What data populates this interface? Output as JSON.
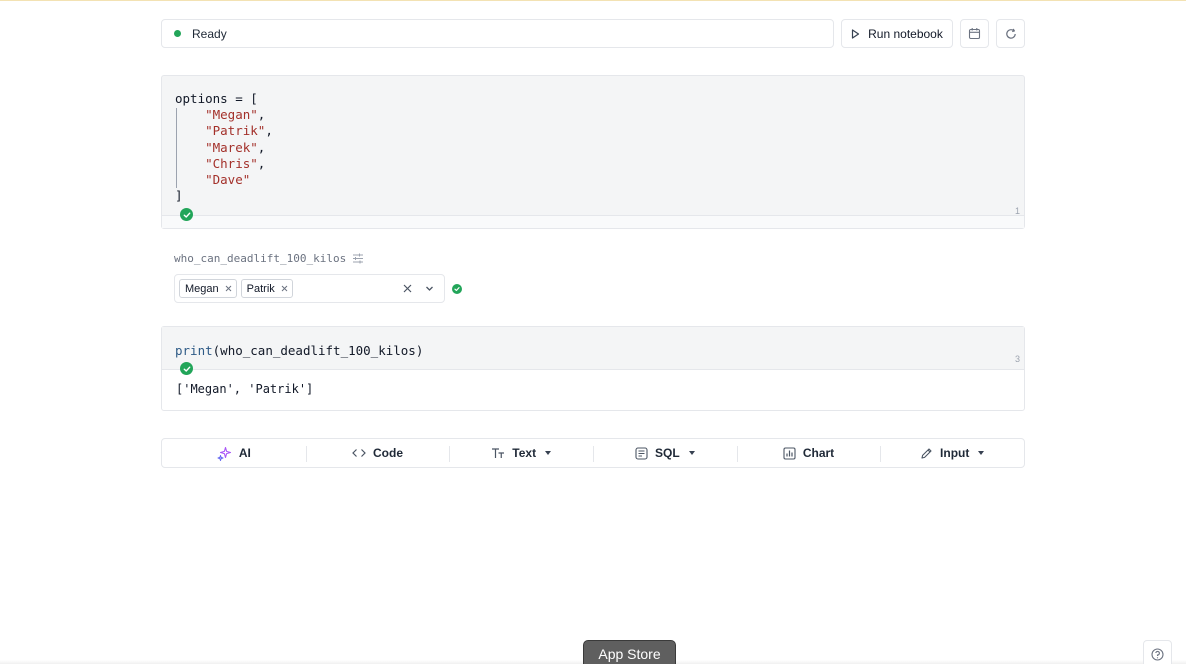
{
  "status": {
    "text": "Ready",
    "color": "#22a559"
  },
  "toolbar_top": {
    "run_label": "Run notebook",
    "icons": [
      "play-icon",
      "calendar-icon",
      "refresh-icon"
    ]
  },
  "cell1": {
    "lines": {
      "l1": "options = [",
      "s1": "\"Megan\"",
      "s2": "\"Patrik\"",
      "s3": "\"Marek\"",
      "s4": "\"Chris\"",
      "s5": "\"Dave\"",
      "close": "]"
    },
    "number": "1"
  },
  "widget": {
    "label": "who_can_deadlift_100_kilos",
    "selected": [
      "Megan",
      "Patrik"
    ]
  },
  "cell3": {
    "fn": "print",
    "args": "(who_can_deadlift_100_kilos)",
    "number": "3",
    "output": "['Megan', 'Patrik']"
  },
  "add_cell": {
    "ai": "AI",
    "code": "Code",
    "text": "Text",
    "sql": "SQL",
    "chart": "Chart",
    "input": "Input"
  },
  "appstore_label": "App Store",
  "colors": {
    "accent_green": "#22a559",
    "string_red": "#a3302a",
    "function_blue": "#2d5a86",
    "ai_purple": "#a855f7"
  }
}
